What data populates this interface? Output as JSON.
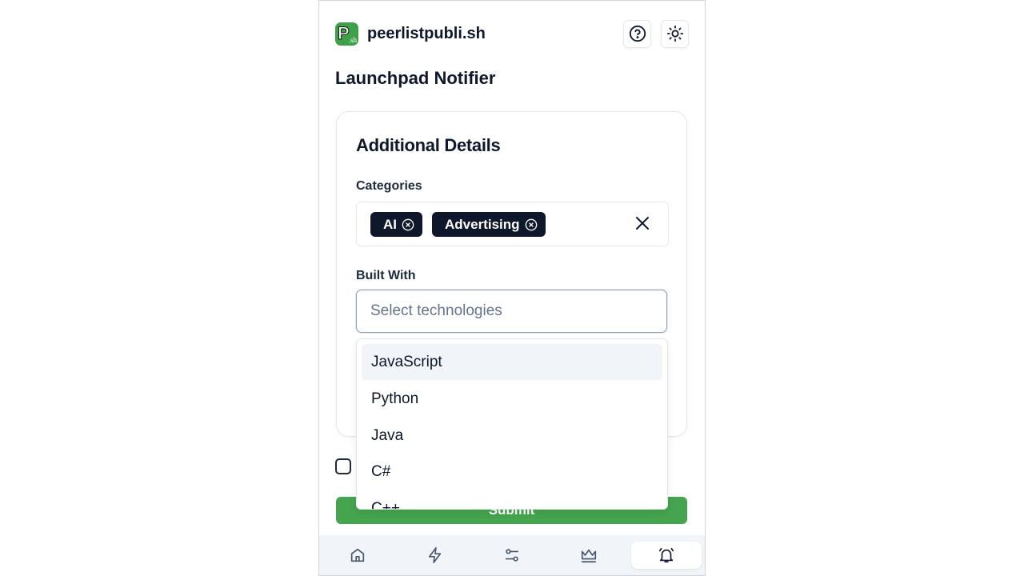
{
  "header": {
    "brand": "peerlistpubli.sh",
    "logo_letter": "P",
    "logo_suffix": ".sh",
    "help_icon": "help-circle-icon",
    "theme_icon": "sun-icon"
  },
  "page_title": "Launchpad Notifier",
  "card": {
    "title": "Additional Details",
    "categories": {
      "label": "Categories",
      "selected": [
        "AI",
        "Advertising"
      ]
    },
    "built_with": {
      "label": "Built With",
      "placeholder": "Select technologies",
      "options": [
        "JavaScript",
        "Python",
        "Java",
        "C#",
        "C++"
      ],
      "highlighted": "JavaScript"
    }
  },
  "submit_label": "Submit",
  "colors": {
    "brand_green": "#45a44e",
    "chip_bg": "#0f172a"
  },
  "nav": {
    "items": [
      {
        "name": "home",
        "icon": "home-icon"
      },
      {
        "name": "launches",
        "icon": "lightning-icon"
      },
      {
        "name": "settings",
        "icon": "sliders-icon"
      },
      {
        "name": "leaderboard",
        "icon": "crown-icon"
      },
      {
        "name": "notifier",
        "icon": "bell-ringing-icon",
        "active": true
      }
    ]
  }
}
